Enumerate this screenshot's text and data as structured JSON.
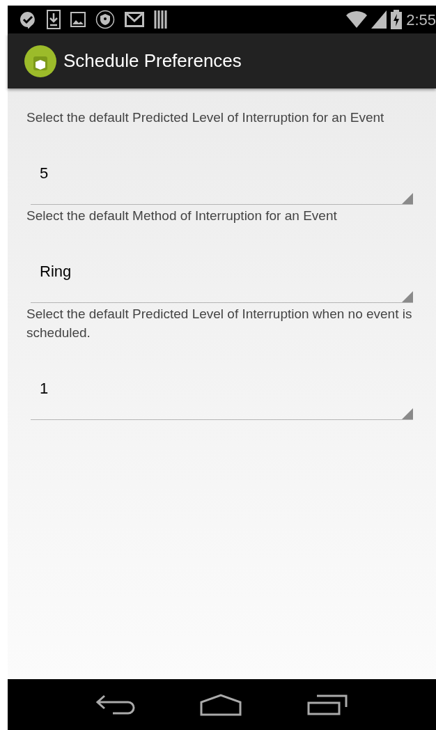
{
  "status_bar": {
    "time": "2:55"
  },
  "action_bar": {
    "title": "Schedule Preferences"
  },
  "preferences": [
    {
      "label": "Select the default Predicted Level of Interruption for an Event",
      "value": "5"
    },
    {
      "label": "Select the default Method of Interruption for an Event",
      "value": "Ring"
    },
    {
      "label": "Select the default Predicted Level of Interruption when no event is scheduled.",
      "value": "1"
    }
  ]
}
